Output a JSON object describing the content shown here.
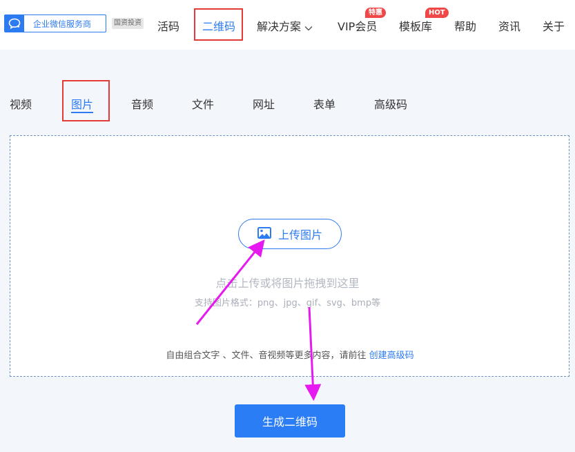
{
  "header": {
    "logo_text": "企业微信服务商",
    "badge": "国资投资",
    "nav": [
      {
        "label": "活码"
      },
      {
        "label": "二维码"
      },
      {
        "label": "解决方案"
      },
      {
        "label": "VIP会员",
        "tag": "特惠"
      },
      {
        "label": "模板库",
        "tag": "HOT"
      },
      {
        "label": "帮助"
      },
      {
        "label": "资讯"
      },
      {
        "label": "关于"
      }
    ]
  },
  "tabs": [
    "视频",
    "图片",
    "音频",
    "文件",
    "网址",
    "表单",
    "高级码"
  ],
  "upload": {
    "button_label": "上传图片",
    "hint_main": "点击上传或将图片拖拽到这里",
    "hint_formats": "支持图片格式：png、jpg、gif、svg、bmp等",
    "hint_more": "自由组合文字 、文件、音视频等更多内容，请前往",
    "hint_link": "创建高级码"
  },
  "generate_button": "生成二维码",
  "colors": {
    "accent": "#2d7bf0",
    "highlight_box": "#e53935",
    "annotation_arrow": "#e619f0",
    "tag_red": "#f04848"
  },
  "icons": [
    "chat-bubble-icon",
    "chevron-down-icon",
    "image-icon"
  ]
}
